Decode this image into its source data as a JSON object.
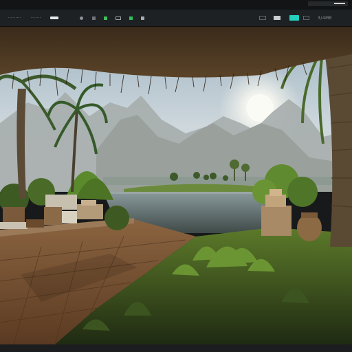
{
  "toolbar": {
    "menu_items": [
      {
        "label": "·········"
      },
      {
        "label": "·······"
      }
    ],
    "accent_color": "#23d0c0",
    "right_label": "3/4ME"
  },
  "viewport": {
    "scene": "tropical lakeside at sunset under thatched pavilion"
  },
  "colors": {
    "toolbar_bg": "#1e2123",
    "frame_bg": "#17191b",
    "sky": "#c7d3da",
    "water": "#5e6e70",
    "floor": "#7a5535"
  }
}
